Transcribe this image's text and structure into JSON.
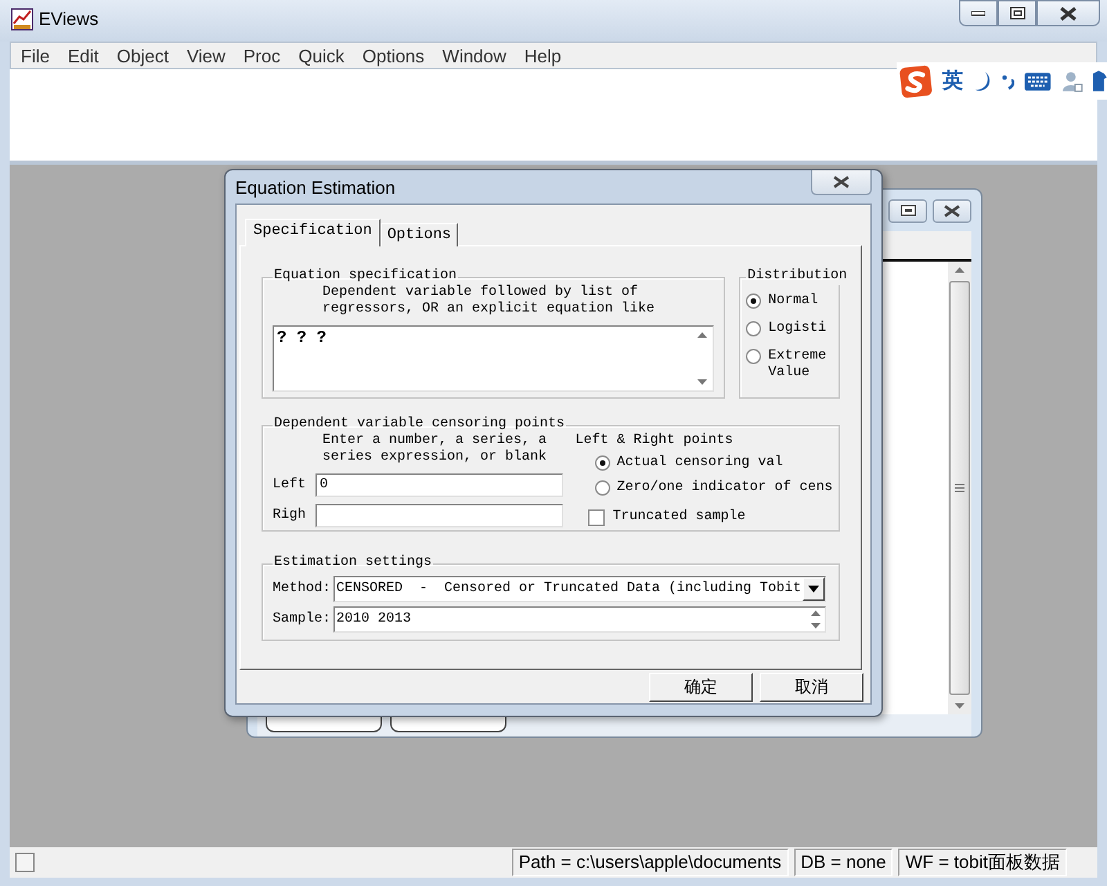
{
  "app": {
    "title": "EViews",
    "menu": [
      "File",
      "Edit",
      "Object",
      "View",
      "Proc",
      "Quick",
      "Options",
      "Window",
      "Help"
    ]
  },
  "ime": {
    "mode": "英"
  },
  "dialog": {
    "title": "Equation Estimation",
    "tabs": [
      {
        "label": "Specification",
        "selected": true
      },
      {
        "label": "Options",
        "selected": false
      }
    ],
    "equation": {
      "title": "Equation specification",
      "hint": [
        "Dependent variable followed by list of",
        "regressors, OR an explicit equation like"
      ],
      "value": "? ? ?"
    },
    "distribution": {
      "title": "Distribution",
      "options": [
        {
          "label": "Normal",
          "selected": true
        },
        {
          "label": "Logisti",
          "selected": false
        },
        {
          "label": "Extreme Value",
          "selected": false
        }
      ]
    },
    "censoring": {
      "title": "Dependent variable censoring points",
      "hint": [
        "Enter a number, a series, a",
        "series expression, or blank"
      ],
      "fields": [
        {
          "label": "Left",
          "value": "0"
        },
        {
          "label": "Righ"
        }
      ],
      "points_title": "Left & Right points",
      "points": [
        {
          "label": "Actual censoring val",
          "selected": true
        },
        {
          "label": "Zero/one indicator of cens",
          "selected": false
        }
      ],
      "truncated": {
        "label": "Truncated sample",
        "checked": false
      }
    },
    "estimation": {
      "title": "Estimation settings",
      "method_label": "Method:",
      "method": "CENSORED  -  Censored or Truncated Data (including Tobit",
      "sample_label": "Sample:",
      "sample": "2010 2013"
    },
    "buttons": [
      "确定",
      "取消"
    ]
  },
  "status_bar": [
    "Path = c:\\users\\apple\\documents",
    "DB = none",
    "WF = tobit面板数据"
  ]
}
